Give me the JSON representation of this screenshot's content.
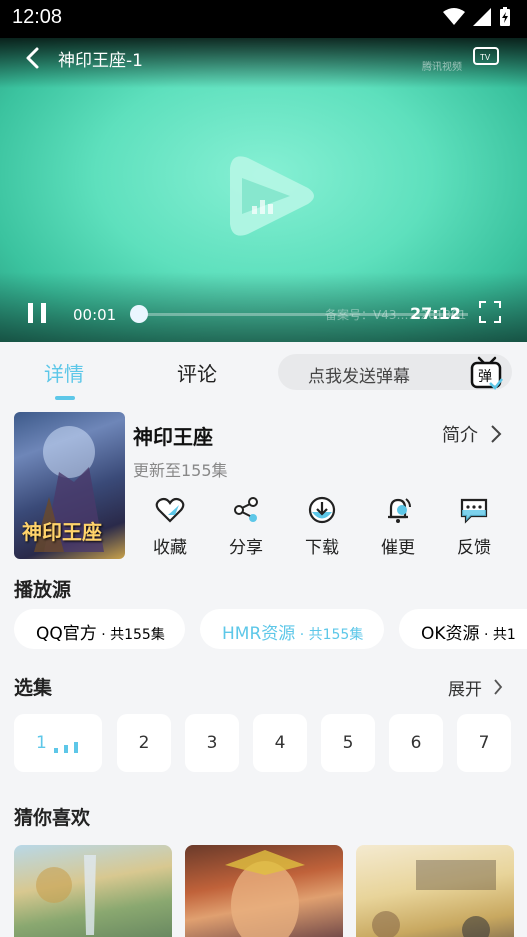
{
  "status_bar": {
    "time": "12:08"
  },
  "player": {
    "title": "神印王座-1",
    "watermark": "腾讯视频",
    "current_time": "00:01",
    "duration": "27:12",
    "record_text": "备案号：V43……201301",
    "progress": 0.01
  },
  "tabs": [
    {
      "label": "详情"
    },
    {
      "label": "评论"
    }
  ],
  "danmu": {
    "placeholder": "点我发送弹幕",
    "icon_label": "弹"
  },
  "info": {
    "poster_text": "神印王座",
    "title": "神印王座",
    "update": "更新至155集",
    "intro": "简介"
  },
  "actions": [
    {
      "label": "收藏",
      "icon": "heart-icon"
    },
    {
      "label": "分享",
      "icon": "share-icon"
    },
    {
      "label": "下载",
      "icon": "download-icon"
    },
    {
      "label": "催更",
      "icon": "bell-icon"
    },
    {
      "label": "反馈",
      "icon": "feedback-icon"
    }
  ],
  "sources": {
    "title": "播放源",
    "items": [
      {
        "name": "QQ官方",
        "count": " · 共155集"
      },
      {
        "name": "HMR资源",
        "count": " · 共155集"
      },
      {
        "name": "OK资源",
        "count": " · 共1"
      }
    ]
  },
  "episodes": {
    "title": "选集",
    "expand": "展开",
    "items": [
      "1",
      "2",
      "3",
      "4",
      "5",
      "6",
      "7"
    ]
  },
  "recommend": {
    "title": "猜你喜欢"
  },
  "colors": {
    "accent": "#5dc7e8",
    "player_bg": "#5ee0bd"
  }
}
